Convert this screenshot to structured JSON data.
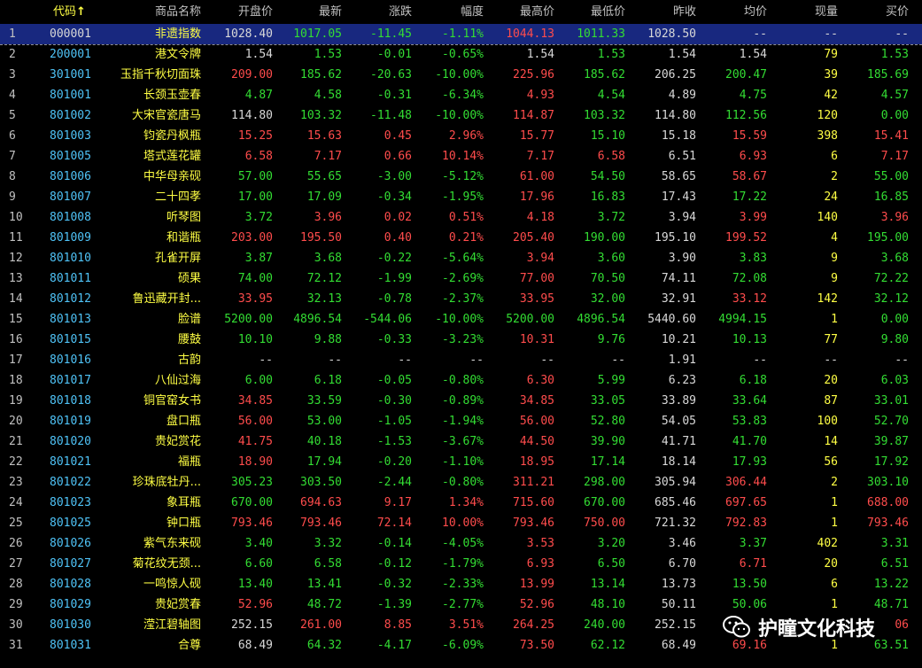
{
  "columns": {
    "idx": "",
    "code": "代码",
    "code_sort_arrow": "↑",
    "name": "商品名称",
    "open": "开盘价",
    "last": "最新",
    "chg": "涨跌",
    "pct": "幅度",
    "high": "最高价",
    "low": "最低价",
    "prev": "昨收",
    "avg": "均价",
    "vol": "现量",
    "bid": "买价"
  },
  "selected_row": 0,
  "rows": [
    {
      "i": "1",
      "code": "000001",
      "name": "非遗指数",
      "open": "1028.40",
      "last": "1017.05",
      "chg": "-11.45",
      "pct": "-1.11%",
      "high": "1044.13",
      "low": "1011.33",
      "prev": "1028.50",
      "avg": "--",
      "vol": "--",
      "bid": "--",
      "colors": {
        "code": "white",
        "open": "white",
        "last": "green",
        "chg": "green",
        "pct": "green",
        "high": "red",
        "low": "green",
        "avg": "white",
        "vol": "white",
        "bid": "white"
      }
    },
    {
      "i": "2",
      "code": "200001",
      "name": "港文令牌",
      "open": "1.54",
      "last": "1.53",
      "chg": "-0.01",
      "pct": "-0.65%",
      "high": "1.54",
      "low": "1.53",
      "prev": "1.54",
      "avg": "1.54",
      "vol": "79",
      "bid": "1.53",
      "colors": {
        "open": "white",
        "last": "green",
        "chg": "green",
        "pct": "green",
        "high": "white",
        "low": "green",
        "avg": "white",
        "vol": "yellow",
        "bid": "green"
      }
    },
    {
      "i": "3",
      "code": "301001",
      "name": "玉指千秋切面珠",
      "open": "209.00",
      "last": "185.62",
      "chg": "-20.63",
      "pct": "-10.00%",
      "high": "225.96",
      "low": "185.62",
      "prev": "206.25",
      "avg": "200.47",
      "vol": "39",
      "bid": "185.69",
      "colors": {
        "open": "red",
        "last": "green",
        "chg": "green",
        "pct": "green",
        "high": "red",
        "low": "green",
        "avg": "green",
        "vol": "yellow",
        "bid": "green"
      }
    },
    {
      "i": "4",
      "code": "801001",
      "name": "长颈玉壶春",
      "open": "4.87",
      "last": "4.58",
      "chg": "-0.31",
      "pct": "-6.34%",
      "high": "4.93",
      "low": "4.54",
      "prev": "4.89",
      "avg": "4.75",
      "vol": "42",
      "bid": "4.57",
      "colors": {
        "open": "green",
        "last": "green",
        "chg": "green",
        "pct": "green",
        "high": "red",
        "low": "green",
        "avg": "green",
        "vol": "yellow",
        "bid": "green"
      }
    },
    {
      "i": "5",
      "code": "801002",
      "name": "大宋官瓷唐马",
      "open": "114.80",
      "last": "103.32",
      "chg": "-11.48",
      "pct": "-10.00%",
      "high": "114.87",
      "low": "103.32",
      "prev": "114.80",
      "avg": "112.56",
      "vol": "120",
      "bid": "0.00",
      "colors": {
        "open": "white",
        "last": "green",
        "chg": "green",
        "pct": "green",
        "high": "red",
        "low": "green",
        "avg": "green",
        "vol": "yellow",
        "bid": "green"
      }
    },
    {
      "i": "6",
      "code": "801003",
      "name": "钧瓷丹枫瓶",
      "open": "15.25",
      "last": "15.63",
      "chg": "0.45",
      "pct": "2.96%",
      "high": "15.77",
      "low": "15.10",
      "prev": "15.18",
      "avg": "15.59",
      "vol": "398",
      "bid": "15.41",
      "colors": {
        "open": "red",
        "last": "red",
        "chg": "red",
        "pct": "red",
        "high": "red",
        "low": "green",
        "avg": "red",
        "vol": "yellow",
        "bid": "red"
      }
    },
    {
      "i": "7",
      "code": "801005",
      "name": "塔式莲花罐",
      "open": "6.58",
      "last": "7.17",
      "chg": "0.66",
      "pct": "10.14%",
      "high": "7.17",
      "low": "6.58",
      "prev": "6.51",
      "avg": "6.93",
      "vol": "6",
      "bid": "7.17",
      "colors": {
        "open": "red",
        "last": "red",
        "chg": "red",
        "pct": "red",
        "high": "red",
        "low": "red",
        "avg": "red",
        "vol": "yellow",
        "bid": "red"
      }
    },
    {
      "i": "8",
      "code": "801006",
      "name": "中华母亲砚",
      "open": "57.00",
      "last": "55.65",
      "chg": "-3.00",
      "pct": "-5.12%",
      "high": "61.00",
      "low": "54.50",
      "prev": "58.65",
      "avg": "58.67",
      "vol": "2",
      "bid": "55.00",
      "colors": {
        "open": "green",
        "last": "green",
        "chg": "green",
        "pct": "green",
        "high": "red",
        "low": "green",
        "avg": "red",
        "vol": "yellow",
        "bid": "green"
      }
    },
    {
      "i": "9",
      "code": "801007",
      "name": "二十四孝",
      "open": "17.00",
      "last": "17.09",
      "chg": "-0.34",
      "pct": "-1.95%",
      "high": "17.96",
      "low": "16.83",
      "prev": "17.43",
      "avg": "17.22",
      "vol": "24",
      "bid": "16.85",
      "colors": {
        "open": "green",
        "last": "green",
        "chg": "green",
        "pct": "green",
        "high": "red",
        "low": "green",
        "avg": "green",
        "vol": "yellow",
        "bid": "green"
      }
    },
    {
      "i": "10",
      "code": "801008",
      "name": "听琴图",
      "open": "3.72",
      "last": "3.96",
      "chg": "0.02",
      "pct": "0.51%",
      "high": "4.18",
      "low": "3.72",
      "prev": "3.94",
      "avg": "3.99",
      "vol": "140",
      "bid": "3.96",
      "colors": {
        "open": "green",
        "last": "red",
        "chg": "red",
        "pct": "red",
        "high": "red",
        "low": "green",
        "avg": "red",
        "vol": "yellow",
        "bid": "red"
      }
    },
    {
      "i": "11",
      "code": "801009",
      "name": "和谐瓶",
      "open": "203.00",
      "last": "195.50",
      "chg": "0.40",
      "pct": "0.21%",
      "high": "205.40",
      "low": "190.00",
      "prev": "195.10",
      "avg": "199.52",
      "vol": "4",
      "bid": "195.00",
      "colors": {
        "open": "red",
        "last": "red",
        "chg": "red",
        "pct": "red",
        "high": "red",
        "low": "green",
        "avg": "red",
        "vol": "yellow",
        "bid": "green"
      }
    },
    {
      "i": "12",
      "code": "801010",
      "name": "孔雀开屏",
      "open": "3.87",
      "last": "3.68",
      "chg": "-0.22",
      "pct": "-5.64%",
      "high": "3.94",
      "low": "3.60",
      "prev": "3.90",
      "avg": "3.83",
      "vol": "9",
      "bid": "3.68",
      "colors": {
        "open": "green",
        "last": "green",
        "chg": "green",
        "pct": "green",
        "high": "red",
        "low": "green",
        "avg": "green",
        "vol": "yellow",
        "bid": "green"
      }
    },
    {
      "i": "13",
      "code": "801011",
      "name": "硕果",
      "open": "74.00",
      "last": "72.12",
      "chg": "-1.99",
      "pct": "-2.69%",
      "high": "77.00",
      "low": "70.50",
      "prev": "74.11",
      "avg": "72.08",
      "vol": "9",
      "bid": "72.22",
      "colors": {
        "open": "green",
        "last": "green",
        "chg": "green",
        "pct": "green",
        "high": "red",
        "low": "green",
        "avg": "green",
        "vol": "yellow",
        "bid": "green"
      }
    },
    {
      "i": "14",
      "code": "801012",
      "name": "鲁迅藏开封...",
      "open": "33.95",
      "last": "32.13",
      "chg": "-0.78",
      "pct": "-2.37%",
      "high": "33.95",
      "low": "32.00",
      "prev": "32.91",
      "avg": "33.12",
      "vol": "142",
      "bid": "32.12",
      "colors": {
        "open": "red",
        "last": "green",
        "chg": "green",
        "pct": "green",
        "high": "red",
        "low": "green",
        "avg": "red",
        "vol": "yellow",
        "bid": "green"
      }
    },
    {
      "i": "15",
      "code": "801013",
      "name": "脸谱",
      "open": "5200.00",
      "last": "4896.54",
      "chg": "-544.06",
      "pct": "-10.00%",
      "high": "5200.00",
      "low": "4896.54",
      "prev": "5440.60",
      "avg": "4994.15",
      "vol": "1",
      "bid": "0.00",
      "colors": {
        "open": "green",
        "last": "green",
        "chg": "green",
        "pct": "green",
        "high": "green",
        "low": "green",
        "avg": "green",
        "vol": "yellow",
        "bid": "green"
      }
    },
    {
      "i": "16",
      "code": "801015",
      "name": "腰鼓",
      "open": "10.10",
      "last": "9.88",
      "chg": "-0.33",
      "pct": "-3.23%",
      "high": "10.31",
      "low": "9.76",
      "prev": "10.21",
      "avg": "10.13",
      "vol": "77",
      "bid": "9.80",
      "colors": {
        "open": "green",
        "last": "green",
        "chg": "green",
        "pct": "green",
        "high": "red",
        "low": "green",
        "avg": "green",
        "vol": "yellow",
        "bid": "green"
      }
    },
    {
      "i": "17",
      "code": "801016",
      "name": "古韵",
      "open": "--",
      "last": "--",
      "chg": "--",
      "pct": "--",
      "high": "--",
      "low": "--",
      "prev": "1.91",
      "avg": "--",
      "vol": "--",
      "bid": "--",
      "colors": {
        "open": "white",
        "last": "white",
        "chg": "white",
        "pct": "white",
        "high": "white",
        "low": "white",
        "avg": "white",
        "vol": "white",
        "bid": "white"
      }
    },
    {
      "i": "18",
      "code": "801017",
      "name": "八仙过海",
      "open": "6.00",
      "last": "6.18",
      "chg": "-0.05",
      "pct": "-0.80%",
      "high": "6.30",
      "low": "5.99",
      "prev": "6.23",
      "avg": "6.18",
      "vol": "20",
      "bid": "6.03",
      "colors": {
        "open": "green",
        "last": "green",
        "chg": "green",
        "pct": "green",
        "high": "red",
        "low": "green",
        "avg": "green",
        "vol": "yellow",
        "bid": "green"
      }
    },
    {
      "i": "19",
      "code": "801018",
      "name": "铜官窑女书",
      "open": "34.85",
      "last": "33.59",
      "chg": "-0.30",
      "pct": "-0.89%",
      "high": "34.85",
      "low": "33.05",
      "prev": "33.89",
      "avg": "33.64",
      "vol": "87",
      "bid": "33.01",
      "colors": {
        "open": "red",
        "last": "green",
        "chg": "green",
        "pct": "green",
        "high": "red",
        "low": "green",
        "avg": "green",
        "vol": "yellow",
        "bid": "green"
      }
    },
    {
      "i": "20",
      "code": "801019",
      "name": "盘口瓶",
      "open": "56.00",
      "last": "53.00",
      "chg": "-1.05",
      "pct": "-1.94%",
      "high": "56.00",
      "low": "52.80",
      "prev": "54.05",
      "avg": "53.83",
      "vol": "100",
      "bid": "52.70",
      "colors": {
        "open": "red",
        "last": "green",
        "chg": "green",
        "pct": "green",
        "high": "red",
        "low": "green",
        "avg": "green",
        "vol": "yellow",
        "bid": "green"
      }
    },
    {
      "i": "21",
      "code": "801020",
      "name": "贵妃赏花",
      "open": "41.75",
      "last": "40.18",
      "chg": "-1.53",
      "pct": "-3.67%",
      "high": "44.50",
      "low": "39.90",
      "prev": "41.71",
      "avg": "41.70",
      "vol": "14",
      "bid": "39.87",
      "colors": {
        "open": "red",
        "last": "green",
        "chg": "green",
        "pct": "green",
        "high": "red",
        "low": "green",
        "avg": "green",
        "vol": "yellow",
        "bid": "green"
      }
    },
    {
      "i": "22",
      "code": "801021",
      "name": "福瓶",
      "open": "18.90",
      "last": "17.94",
      "chg": "-0.20",
      "pct": "-1.10%",
      "high": "18.95",
      "low": "17.14",
      "prev": "18.14",
      "avg": "17.93",
      "vol": "56",
      "bid": "17.92",
      "colors": {
        "open": "red",
        "last": "green",
        "chg": "green",
        "pct": "green",
        "high": "red",
        "low": "green",
        "avg": "green",
        "vol": "yellow",
        "bid": "green"
      }
    },
    {
      "i": "23",
      "code": "801022",
      "name": "珍珠底牡丹...",
      "open": "305.23",
      "last": "303.50",
      "chg": "-2.44",
      "pct": "-0.80%",
      "high": "311.21",
      "low": "298.00",
      "prev": "305.94",
      "avg": "306.44",
      "vol": "2",
      "bid": "303.10",
      "colors": {
        "open": "green",
        "last": "green",
        "chg": "green",
        "pct": "green",
        "high": "red",
        "low": "green",
        "avg": "red",
        "vol": "yellow",
        "bid": "green"
      }
    },
    {
      "i": "24",
      "code": "801023",
      "name": "象耳瓶",
      "open": "670.00",
      "last": "694.63",
      "chg": "9.17",
      "pct": "1.34%",
      "high": "715.60",
      "low": "670.00",
      "prev": "685.46",
      "avg": "697.65",
      "vol": "1",
      "bid": "688.00",
      "colors": {
        "open": "green",
        "last": "red",
        "chg": "red",
        "pct": "red",
        "high": "red",
        "low": "green",
        "avg": "red",
        "vol": "yellow",
        "bid": "red"
      }
    },
    {
      "i": "25",
      "code": "801025",
      "name": "钟口瓶",
      "open": "793.46",
      "last": "793.46",
      "chg": "72.14",
      "pct": "10.00%",
      "high": "793.46",
      "low": "750.00",
      "prev": "721.32",
      "avg": "792.83",
      "vol": "1",
      "bid": "793.46",
      "colors": {
        "open": "red",
        "last": "red",
        "chg": "red",
        "pct": "red",
        "high": "red",
        "low": "red",
        "avg": "red",
        "vol": "yellow",
        "bid": "red"
      }
    },
    {
      "i": "26",
      "code": "801026",
      "name": "紫气东来砚",
      "open": "3.40",
      "last": "3.32",
      "chg": "-0.14",
      "pct": "-4.05%",
      "high": "3.53",
      "low": "3.20",
      "prev": "3.46",
      "avg": "3.37",
      "vol": "402",
      "bid": "3.31",
      "colors": {
        "open": "green",
        "last": "green",
        "chg": "green",
        "pct": "green",
        "high": "red",
        "low": "green",
        "avg": "green",
        "vol": "yellow",
        "bid": "green"
      }
    },
    {
      "i": "27",
      "code": "801027",
      "name": "菊花纹无颈...",
      "open": "6.60",
      "last": "6.58",
      "chg": "-0.12",
      "pct": "-1.79%",
      "high": "6.93",
      "low": "6.50",
      "prev": "6.70",
      "avg": "6.71",
      "vol": "20",
      "bid": "6.51",
      "colors": {
        "open": "green",
        "last": "green",
        "chg": "green",
        "pct": "green",
        "high": "red",
        "low": "green",
        "avg": "red",
        "vol": "yellow",
        "bid": "green"
      }
    },
    {
      "i": "28",
      "code": "801028",
      "name": "一鸣惊人砚",
      "open": "13.40",
      "last": "13.41",
      "chg": "-0.32",
      "pct": "-2.33%",
      "high": "13.99",
      "low": "13.14",
      "prev": "13.73",
      "avg": "13.50",
      "vol": "6",
      "bid": "13.22",
      "colors": {
        "open": "green",
        "last": "green",
        "chg": "green",
        "pct": "green",
        "high": "red",
        "low": "green",
        "avg": "green",
        "vol": "yellow",
        "bid": "green"
      }
    },
    {
      "i": "29",
      "code": "801029",
      "name": "贵妃赏春",
      "open": "52.96",
      "last": "48.72",
      "chg": "-1.39",
      "pct": "-2.77%",
      "high": "52.96",
      "low": "48.10",
      "prev": "50.11",
      "avg": "50.06",
      "vol": "1",
      "bid": "48.71",
      "colors": {
        "open": "red",
        "last": "green",
        "chg": "green",
        "pct": "green",
        "high": "red",
        "low": "green",
        "avg": "green",
        "vol": "yellow",
        "bid": "green"
      }
    },
    {
      "i": "30",
      "code": "801030",
      "name": "滢江碧轴图",
      "open": "252.15",
      "last": "261.00",
      "chg": "8.85",
      "pct": "3.51%",
      "high": "264.25",
      "low": "240.00",
      "prev": "252.15",
      "avg": "",
      "vol": "",
      "bid": "06",
      "colors": {
        "open": "white",
        "last": "red",
        "chg": "red",
        "pct": "red",
        "high": "red",
        "low": "green",
        "avg": "red",
        "vol": "yellow",
        "bid": "red"
      }
    },
    {
      "i": "31",
      "code": "801031",
      "name": "合尊",
      "open": "68.49",
      "last": "64.32",
      "chg": "-4.17",
      "pct": "-6.09%",
      "high": "73.50",
      "low": "62.12",
      "prev": "68.49",
      "avg": "69.16",
      "vol": "1",
      "bid": "63.51",
      "colors": {
        "open": "white",
        "last": "green",
        "chg": "green",
        "pct": "green",
        "high": "red",
        "low": "green",
        "avg": "red",
        "vol": "yellow",
        "bid": "green"
      }
    }
  ],
  "watermark": {
    "icon": "wechat-icon",
    "text": "护瞳文化科技"
  },
  "theme": {
    "background": "#000000",
    "selected_row_bg": "#18287f",
    "up": "#ff4c4c",
    "down": "#33dd33",
    "flat": "#d8d8d8",
    "volume": "#ffff44",
    "code": "#4fc3f7",
    "name": "#ffff44"
  }
}
